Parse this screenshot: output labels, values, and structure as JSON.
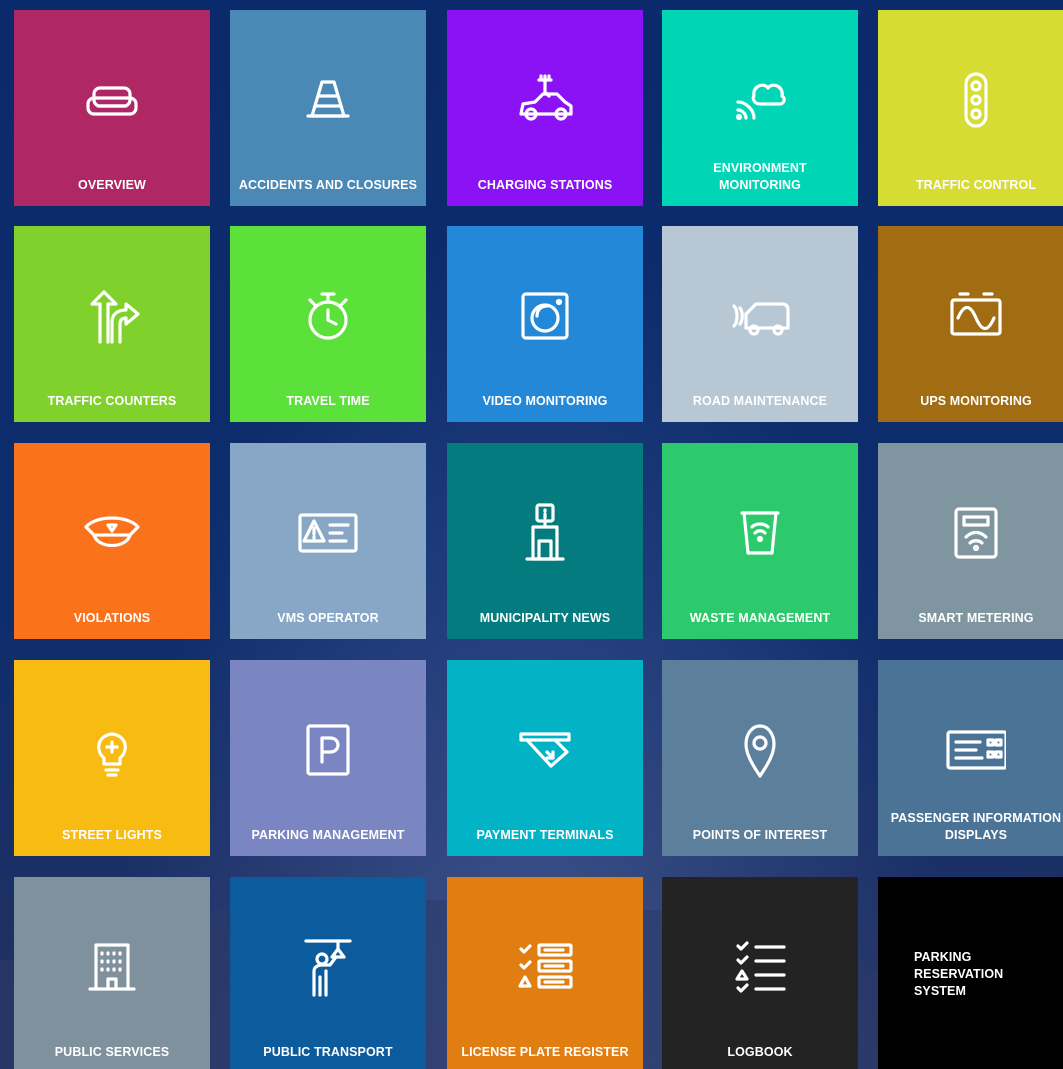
{
  "tiles": [
    {
      "id": "overview",
      "label": "OVERVIEW",
      "icon": "sofa-icon",
      "color": "#b02765"
    },
    {
      "id": "accidents-and-closures",
      "label": "ACCIDENTS AND CLOSURES",
      "icon": "traffic-cone-icon",
      "color": "#4a88b5"
    },
    {
      "id": "charging-stations",
      "label": "CHARGING STATIONS",
      "icon": "electric-car-icon",
      "color": "#8b12f5"
    },
    {
      "id": "environment-monitoring",
      "label": "ENVIRONMENT MONITORING",
      "icon": "cloud-signal-icon",
      "color": "#00d5b6"
    },
    {
      "id": "traffic-control",
      "label": "TRAFFIC CONTROL",
      "icon": "traffic-light-icon",
      "color": "#d6dc32"
    },
    {
      "id": "traffic-counters",
      "label": "TRAFFIC COUNTERS",
      "icon": "road-arrows-icon",
      "color": "#80d12b"
    },
    {
      "id": "travel-time",
      "label": "TRAVEL TIME",
      "icon": "stopwatch-icon",
      "color": "#5ce03a"
    },
    {
      "id": "video-monitoring",
      "label": "VIDEO MONITORING",
      "icon": "camera-icon",
      "color": "#2388d8"
    },
    {
      "id": "road-maintenance",
      "label": "ROAD MAINTENANCE",
      "icon": "sweeper-truck-icon",
      "color": "#b7c7d4"
    },
    {
      "id": "ups-monitoring",
      "label": "UPS MONITORING",
      "icon": "battery-wave-icon",
      "color": "#a16c12"
    },
    {
      "id": "violations",
      "label": "VIOLATIONS",
      "icon": "police-cap-icon",
      "color": "#fa731c"
    },
    {
      "id": "vms-operator",
      "label": "VMS OPERATOR",
      "icon": "warning-sign-icon",
      "color": "#88a7c7"
    },
    {
      "id": "municipality-news",
      "label": "MUNICIPALITY NEWS",
      "icon": "info-kiosk-icon",
      "color": "#047b7e"
    },
    {
      "id": "waste-management",
      "label": "WASTE MANAGEMENT",
      "icon": "waste-bin-icon",
      "color": "#2dc96d"
    },
    {
      "id": "smart-metering",
      "label": "SMART METERING",
      "icon": "meter-icon",
      "color": "#7f959f"
    },
    {
      "id": "street-lights",
      "label": "STREET LIGHTS",
      "icon": "light-bulb-icon",
      "color": "#f8bb12"
    },
    {
      "id": "parking-management",
      "label": "PARKING MANAGEMENT",
      "icon": "parking-sign-icon",
      "color": "#7a86c2"
    },
    {
      "id": "payment-terminals",
      "label": "PAYMENT TERMINALS",
      "icon": "card-payment-icon",
      "color": "#02b3c5"
    },
    {
      "id": "points-of-interest",
      "label": "POINTS OF INTEREST",
      "icon": "map-pin-icon",
      "color": "#5c7f9c"
    },
    {
      "id": "passenger-information-displays",
      "label": "PASSENGER INFORMATION DISPLAYS",
      "icon": "display-board-icon",
      "color": "#4a7396"
    },
    {
      "id": "public-services",
      "label": "PUBLIC SERVICES",
      "icon": "building-icon",
      "color": "#7f919d"
    },
    {
      "id": "public-transport",
      "label": "PUBLIC TRANSPORT",
      "icon": "passenger-handle-icon",
      "color": "#0c5b9c"
    },
    {
      "id": "license-plate-register",
      "label": "LICENSE PLATE REGISTER",
      "icon": "stacked-list-icon",
      "color": "#e07e12"
    },
    {
      "id": "logbook",
      "label": "LOGBOOK",
      "icon": "checklist-icon",
      "color": "#232323"
    },
    {
      "id": "parking-reservation-system",
      "label": "PARKING RESERVATION SYSTEM",
      "icon": "",
      "color": "#000000"
    }
  ]
}
